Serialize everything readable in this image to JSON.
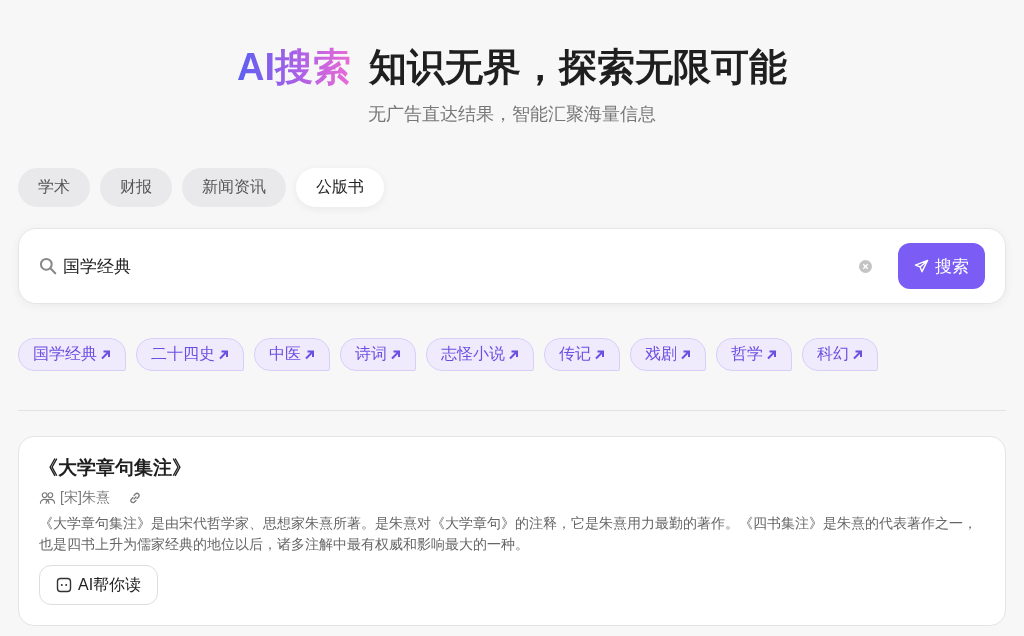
{
  "hero": {
    "brand": "AI搜索",
    "title": "知识无界，探索无限可能",
    "subtitle": "无广告直达结果，智能汇聚海量信息"
  },
  "tabs": [
    {
      "label": "学术",
      "selected": false
    },
    {
      "label": "财报",
      "selected": false
    },
    {
      "label": "新闻资讯",
      "selected": false
    },
    {
      "label": "公版书",
      "selected": true
    }
  ],
  "search": {
    "value": "国学经典",
    "button": "搜索"
  },
  "tags": [
    "国学经典",
    "二十四史",
    "中医",
    "诗词",
    "志怪小说",
    "传记",
    "戏剧",
    "哲学",
    "科幻"
  ],
  "result": {
    "title": "《大学章句集注》",
    "author": "[宋]朱熹",
    "description": "《大学章句集注》是由宋代哲学家、思想家朱熹所著。是朱熹对《大学章句》的注释，它是朱熹用力最勤的著作。《四书集注》是朱熹的代表著作之一，也是四书上升为儒家经典的地位以后，诸多注解中最有权威和影响最大的一种。",
    "button": "AI帮你读"
  }
}
